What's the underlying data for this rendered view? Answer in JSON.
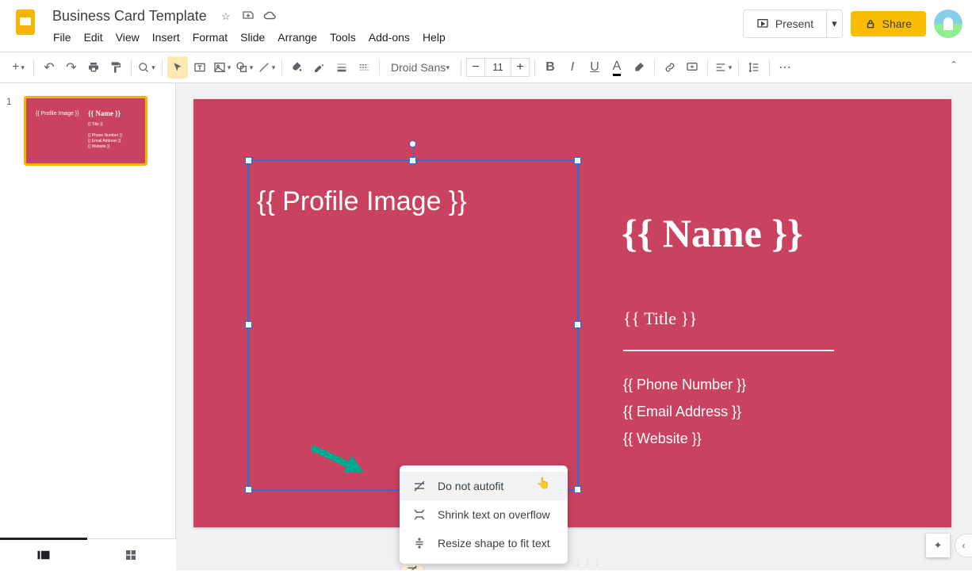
{
  "doc": {
    "title": "Business Card Template"
  },
  "menus": [
    "File",
    "Edit",
    "View",
    "Insert",
    "Format",
    "Slide",
    "Arrange",
    "Tools",
    "Add-ons",
    "Help"
  ],
  "header": {
    "present": "Present",
    "share": "Share"
  },
  "toolbar": {
    "font": "Droid Sans",
    "fontSize": "11"
  },
  "thumb": {
    "num": "1",
    "t1": "{{ Profile Image }}",
    "t2": "{{ Name }}",
    "t3": "{{ Title }}",
    "t4": "{{ Phone Number }}",
    "t5": "{{ Email Address }}",
    "t6": "{{ Website }}"
  },
  "slide": {
    "profileImage": "{{ Profile Image }}",
    "name": "{{ Name }}",
    "title": "{{ Title }}",
    "phone": "{{ Phone Number }}",
    "email": "{{ Email Address }}",
    "website": "{{ Website }}"
  },
  "ctx": {
    "opt1": "Do not autofit",
    "opt2": "Shrink text on overflow",
    "opt3": "Resize shape to fit text"
  }
}
